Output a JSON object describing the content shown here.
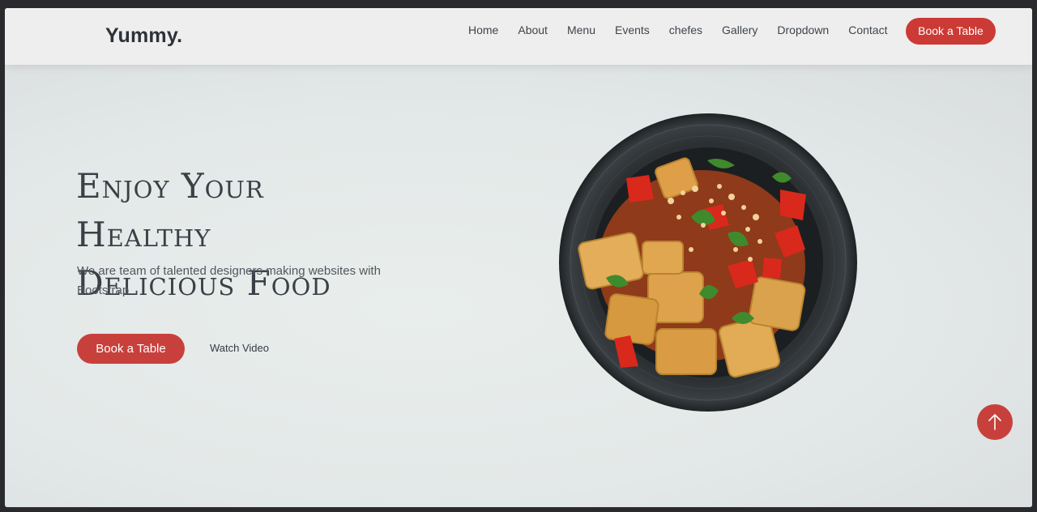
{
  "header": {
    "logo": "Yummy.",
    "nav": [
      "Home",
      "About",
      "Menu",
      "Events",
      "chefes",
      "Gallery",
      "Dropdown",
      "Contact"
    ],
    "cta": "Book a Table"
  },
  "hero": {
    "title_line1": "Enjoy Your Healthy",
    "title_line2": "Delicious Food",
    "subtitle": "We are team of talented designers making websites with Bootstrap",
    "cta": "Book a Table",
    "secondary": "Watch Video"
  },
  "colors": {
    "accent": "#cc3a35",
    "background": "#eceeee",
    "text": "#3b4047"
  },
  "icons": {
    "scroll_top": "arrow-up-icon",
    "food": "food-bowl-image"
  }
}
